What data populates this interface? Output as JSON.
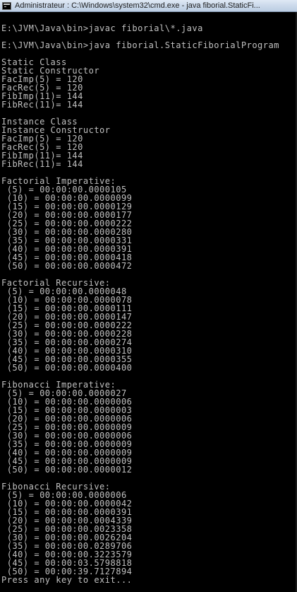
{
  "window": {
    "title": "Administrateur : C:\\Windows\\system32\\cmd.exe - java  fiborial.StaticFi..."
  },
  "console": {
    "lines": [
      "",
      "E:\\JVM\\Java\\bin>javac fiborial\\*.java",
      "",
      "E:\\JVM\\Java\\bin>java fiborial.StaticFiborialProgram",
      "",
      "Static Class",
      "Static Constructor",
      "FacImp(5) = 120",
      "FacRec(5) = 120",
      "FibImp(11)= 144",
      "FibRec(11)= 144",
      "",
      "Instance Class",
      "Instance Constructor",
      "FacImp(5) = 120",
      "FacRec(5) = 120",
      "FibImp(11)= 144",
      "FibRec(11)= 144",
      "",
      "Factorial Imperative:",
      " (5) = 00:00:00.0000105",
      " (10) = 00:00:00.0000099",
      " (15) = 00:00:00.0000129",
      " (20) = 00:00:00.0000177",
      " (25) = 00:00:00.0000222",
      " (30) = 00:00:00.0000280",
      " (35) = 00:00:00.0000331",
      " (40) = 00:00:00.0000391",
      " (45) = 00:00:00.0000418",
      " (50) = 00:00:00.0000472",
      "",
      "Factorial Recursive:",
      " (5) = 00:00:00.0000048",
      " (10) = 00:00:00.0000078",
      " (15) = 00:00:00.0000111",
      " (20) = 00:00:00.0000147",
      " (25) = 00:00:00.0000222",
      " (30) = 00:00:00.0000228",
      " (35) = 00:00:00.0000274",
      " (40) = 00:00:00.0000310",
      " (45) = 00:00:00.0000355",
      " (50) = 00:00:00.0000400",
      "",
      "Fibonacci Imperative:",
      " (5) = 00:00:00.0000027",
      " (10) = 00:00:00.0000006",
      " (15) = 00:00:00.0000003",
      " (20) = 00:00:00.0000006",
      " (25) = 00:00:00.0000009",
      " (30) = 00:00:00.0000006",
      " (35) = 00:00:00.0000009",
      " (40) = 00:00:00.0000009",
      " (45) = 00:00:00.0000009",
      " (50) = 00:00:00.0000012",
      "",
      "Fibonacci Recursive:",
      " (5) = 00:00:00.0000006",
      " (10) = 00:00:00.0000042",
      " (15) = 00:00:00.0000391",
      " (20) = 00:00:00.0004339",
      " (25) = 00:00:00.0023358",
      " (30) = 00:00:00.0026204",
      " (35) = 00:00:00.0289706",
      " (40) = 00:00:00.3223579",
      " (45) = 00:00:03.5798818",
      " (50) = 00:00:39.7127894",
      "Press any key to exit..."
    ]
  },
  "colors": {
    "console_background": "#000000",
    "console_text": "#c0c0c0",
    "titlebar": "#c9d8ea"
  },
  "icons": {
    "app_icon": "cmd-console-icon"
  }
}
